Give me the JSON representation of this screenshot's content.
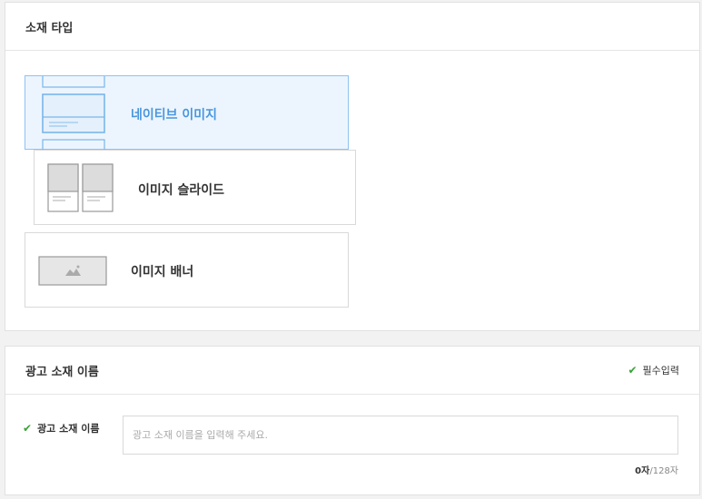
{
  "type_section": {
    "title": "소재 타입",
    "options": [
      {
        "label": "네이티브 이미지",
        "icon": "native-image-icon",
        "selected": true
      },
      {
        "label": "이미지 슬라이드",
        "icon": "image-slide-icon",
        "selected": false
      },
      {
        "label": "이미지 배너",
        "icon": "image-banner-icon",
        "selected": false
      }
    ]
  },
  "name_section": {
    "title": "광고 소재 이름",
    "required_label": "필수입력",
    "field_label": "광고 소재 이름",
    "placeholder": "광고 소재 이름을 입력해 주세요.",
    "value": "",
    "count": "0자",
    "max": "/128자"
  },
  "colors": {
    "selected_bg": "#ecf5fe",
    "selected_border": "#8ec2f0",
    "selected_text": "#4a97dd",
    "check_green": "#3aa335"
  }
}
